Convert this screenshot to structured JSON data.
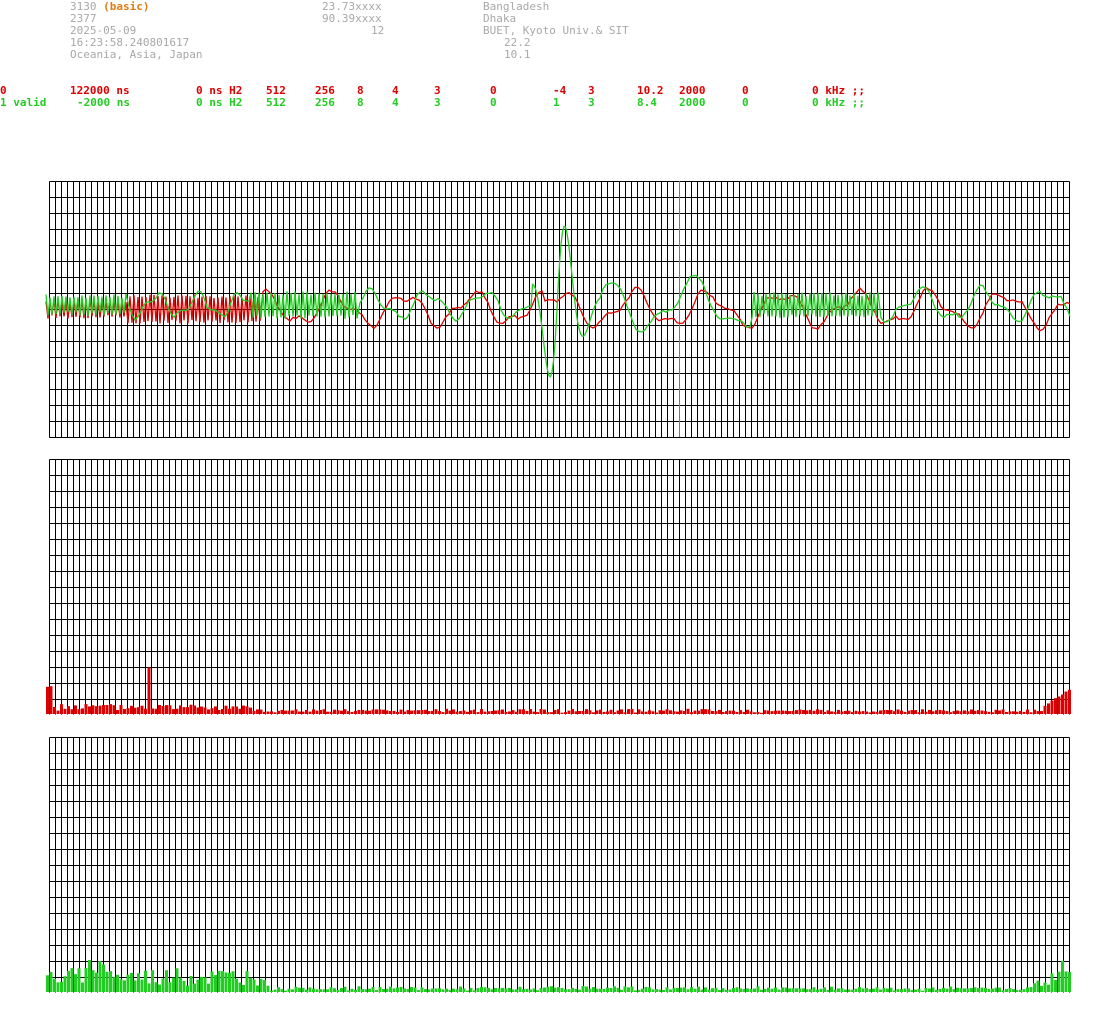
{
  "header": {
    "station_id": "3130",
    "station_mode": "(basic)",
    "value_2377": "2377",
    "date": "2025-05-09",
    "time": "16:23:58.240801617",
    "region": "Oceania, Asia, Japan",
    "lat": "23.73xxxx",
    "lon": "90.39xxxx",
    "n12": "12",
    "country": "Bangladesh",
    "city": "Dhaka",
    "institution": "BUET, Kyoto Univ.& SIT",
    "v1": "22.2",
    "v2": "10.1"
  },
  "channels": [
    {
      "label": "0",
      "offset": "122000 ns",
      "ns_h2": "0 ns H2",
      "c1": "512",
      "c2": "256",
      "c3": "8",
      "c4": "4",
      "c5": "3",
      "c6": "0",
      "c7": "-4",
      "c8": "3",
      "c9": "10.2",
      "c10": "2000",
      "c11": "0",
      "khz": "0 kHz ;;",
      "color": "#dd0000"
    },
    {
      "label": "1 valid",
      "offset": "-2000 ns",
      "ns_h2": "0 ns H2",
      "c1": "512",
      "c2": "256",
      "c3": "8",
      "c4": "4",
      "c5": "3",
      "c6": "0",
      "c7": "1",
      "c8": "3",
      "c9": "8.4",
      "c10": "2000",
      "c11": "0",
      "khz": "0 kHz ;;",
      "color": "#22cc22"
    }
  ],
  "colors": {
    "grid": "#000000",
    "channel0": "#dd0000",
    "channel1": "#22cc22",
    "marker": "#aa6666"
  }
}
